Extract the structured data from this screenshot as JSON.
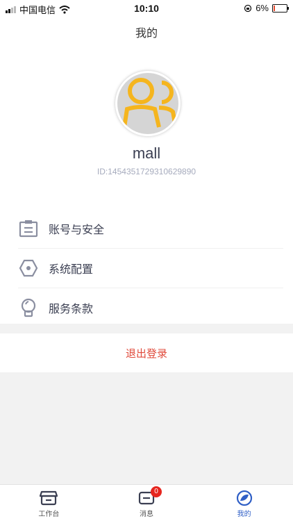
{
  "status_bar": {
    "carrier": "中国电信",
    "time": "10:10",
    "battery": "6%",
    "battery_level": 0.06
  },
  "header": {
    "title": "我的"
  },
  "profile": {
    "username": "mall",
    "user_id": "ID:1454351729310629890"
  },
  "menu": [
    {
      "label": "账号与安全",
      "icon": "clipboard-icon"
    },
    {
      "label": "系统配置",
      "icon": "hexagon-settings-icon"
    },
    {
      "label": "服务条款",
      "icon": "lightbulb-icon"
    }
  ],
  "logout": {
    "label": "退出登录"
  },
  "tabbar": {
    "tabs": [
      {
        "label": "工作台",
        "icon": "store-icon",
        "active": false
      },
      {
        "label": "消息",
        "icon": "message-icon",
        "active": false,
        "badge": "0"
      },
      {
        "label": "我的",
        "icon": "profile-icon",
        "active": true
      }
    ]
  },
  "colors": {
    "accent": "#2f5fc6",
    "logout": "#e0493a",
    "badge": "#e6261f",
    "avatar_figure": "#f5b51e",
    "icon_gray": "#8a8ea0"
  }
}
